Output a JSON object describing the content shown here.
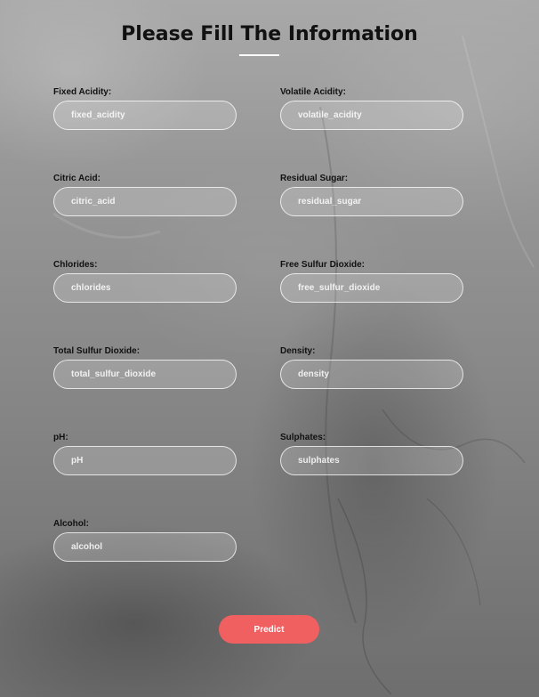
{
  "form": {
    "title": "Please Fill The Information",
    "fields": [
      {
        "label": "Fixed Acidity:",
        "placeholder": "fixed_acidity"
      },
      {
        "label": "Volatile Acidity:",
        "placeholder": "volatile_acidity"
      },
      {
        "label": "Citric Acid:",
        "placeholder": "citric_acid"
      },
      {
        "label": "Residual Sugar:",
        "placeholder": "residual_sugar"
      },
      {
        "label": "Chlorides:",
        "placeholder": "chlorides"
      },
      {
        "label": "Free Sulfur Dioxide:",
        "placeholder": "free_sulfur_dioxide"
      },
      {
        "label": "Total Sulfur Dioxide:",
        "placeholder": "total_sulfur_dioxide"
      },
      {
        "label": "Density:",
        "placeholder": "density"
      },
      {
        "label": "pH:",
        "placeholder": "pH"
      },
      {
        "label": "Sulphates:",
        "placeholder": "sulphates"
      },
      {
        "label": "Alcohol:",
        "placeholder": "alcohol"
      }
    ],
    "submit_label": "Predict"
  },
  "colors": {
    "button": "#f06060",
    "title_text": "#111111",
    "input_border": "#ffffff"
  }
}
